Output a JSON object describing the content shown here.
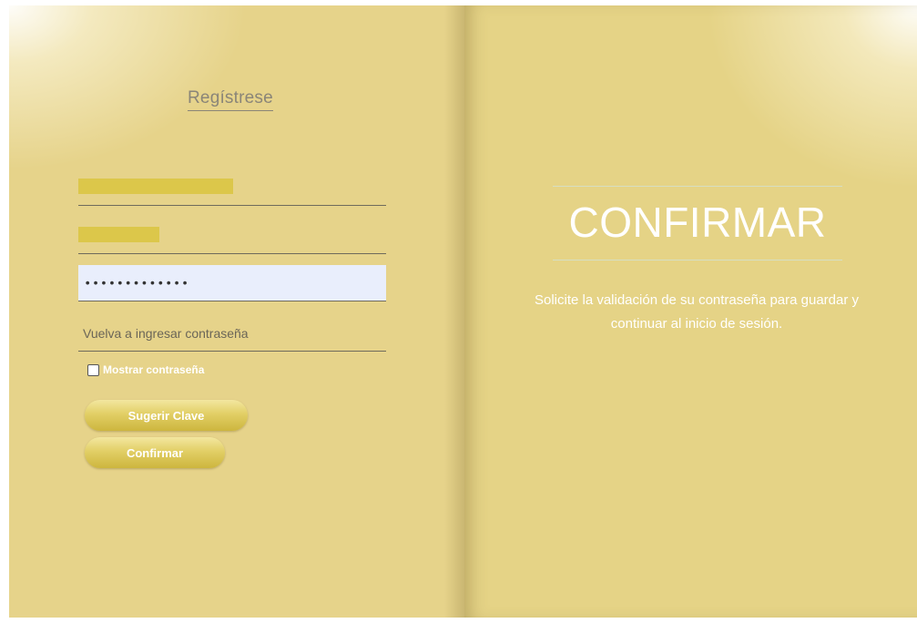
{
  "signup": {
    "title": "Regístrese",
    "password_mask": "•••••••••••••",
    "repeat_password_placeholder": "Vuelva a ingresar contraseña",
    "show_password_label": "Mostrar contraseña",
    "suggest_button": "Sugerir Clave",
    "confirm_button": "Confirmar"
  },
  "overlay": {
    "heading": "CONFIRMAR",
    "description": "Solicite la validación de su contraseña para guardar y continuar al inicio de sesión."
  },
  "colors": {
    "panel_background": "#e6d38a",
    "redaction": "#dcc74a",
    "password_field_fill": "#e9eefc",
    "button_gold": "#e2cf66",
    "text_white": "#ffffff"
  }
}
